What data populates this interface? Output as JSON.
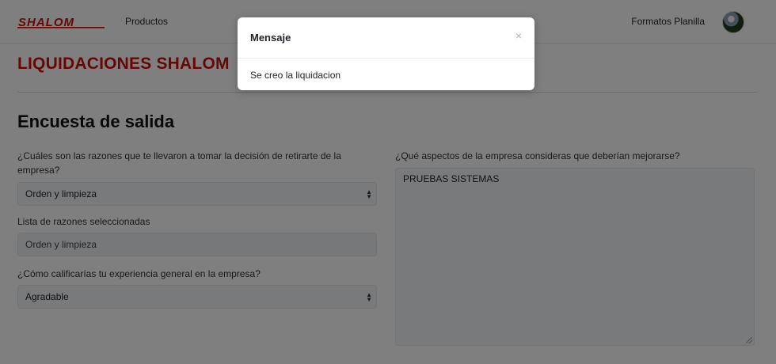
{
  "navbar": {
    "brand": "SHALOM",
    "links": [
      "Productos",
      "Formatos Planilla"
    ]
  },
  "page": {
    "title": "LIQUIDACIONES SHALOM",
    "section_title": "Encuesta de salida"
  },
  "form": {
    "q1_label": "¿Cuáles son las razones que te llevaron a tomar la decisión de retirarte de la empresa?",
    "q1_value": "Orden y limpieza",
    "list_label": "Lista de razones seleccionadas",
    "list_value": "Orden y limpieza",
    "q3_label": "¿Cómo calificarías tu experiencia general en la empresa?",
    "q3_value": "Agradable",
    "q2_label": "¿Qué aspectos de la empresa consideras que deberían mejorarse?",
    "q2_value": "PRUEBAS SISTEMAS"
  },
  "modal": {
    "title": "Mensaje",
    "close": "×",
    "body": "Se creo la liquidacion"
  },
  "icons": {
    "select_chevron": "⌃⌄",
    "brand_color": "#d10c0c"
  }
}
